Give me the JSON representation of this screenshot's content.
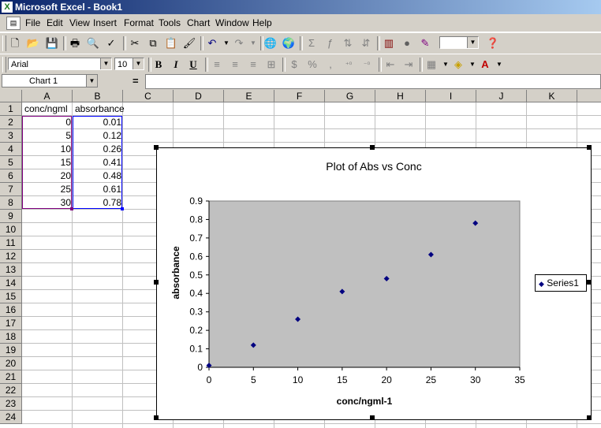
{
  "window": {
    "title": "Microsoft Excel - Book1"
  },
  "menu": [
    "File",
    "Edit",
    "View",
    "Insert",
    "Format",
    "Tools",
    "Chart",
    "Window",
    "Help"
  ],
  "format_toolbar": {
    "font_name": "Arial",
    "font_size": "10",
    "bold": "B",
    "italic": "I",
    "underline": "U"
  },
  "formula_bar": {
    "name_box": "Chart 1",
    "equals": "="
  },
  "columns": [
    "A",
    "B",
    "C",
    "D",
    "E",
    "F",
    "G",
    "H",
    "I",
    "J",
    "K"
  ],
  "rows": [
    "1",
    "2",
    "3",
    "4",
    "5",
    "6",
    "7",
    "8",
    "9",
    "10",
    "11",
    "12",
    "13",
    "14",
    "15",
    "16",
    "17",
    "18",
    "19",
    "20",
    "21",
    "22",
    "23",
    "24"
  ],
  "cells": {
    "A1": "conc/ngml",
    "B1": "absorbance",
    "A": [
      "0",
      "5",
      "10",
      "15",
      "20",
      "25",
      "30"
    ],
    "B": [
      "0.01",
      "0.12",
      "0.26",
      "0.41",
      "0.48",
      "0.61",
      "0.78"
    ]
  },
  "colors": {
    "series": "#000080",
    "plot_area": "#c0c0c0",
    "selection_a": "#800080",
    "selection_b": "#0000ff"
  },
  "chart_data": {
    "type": "scatter",
    "title": "Plot of Abs vs Conc",
    "xlabel": "conc/ngml-1",
    "ylabel": "absorbance",
    "xlim": [
      0,
      35
    ],
    "ylim": [
      0,
      0.9
    ],
    "xticks": [
      "0",
      "5",
      "10",
      "15",
      "20",
      "25",
      "30",
      "35"
    ],
    "yticks": [
      "0",
      "0.1",
      "0.2",
      "0.3",
      "0.4",
      "0.5",
      "0.6",
      "0.7",
      "0.8",
      "0.9"
    ],
    "grid": false,
    "legend": "right",
    "series": [
      {
        "name": "Series1",
        "x": [
          0,
          5,
          10,
          15,
          20,
          25,
          30
        ],
        "y": [
          0.01,
          0.12,
          0.26,
          0.41,
          0.48,
          0.61,
          0.78
        ]
      }
    ]
  }
}
